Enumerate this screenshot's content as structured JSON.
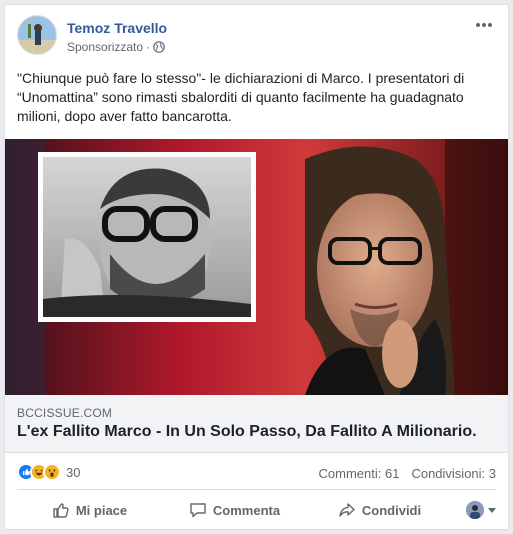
{
  "post": {
    "author": "Temoz Travello",
    "sponsored_label": "Sponsorizzato",
    "sponsored_separator": "·",
    "text": "\"Chiunque può fare lo stesso\"- le dichiarazioni di Marco. I presentatori di “Unomattina” sono rimasti sbalorditi di quanto facilmente ha guadagnato milioni, dopo aver fatto bancarotta."
  },
  "link_preview": {
    "domain": "BCCISSUE.COM",
    "title": "L'ex Fallito Marco - In Un Solo Passo, Da Fallito A Milionario."
  },
  "stats": {
    "reactions": [
      "like-icon",
      "haha-icon",
      "wow-icon"
    ],
    "reaction_count": "30",
    "comments": "Commenti: 61",
    "shares": "Condivisioni: 3"
  },
  "actions": {
    "like": "Mi piace",
    "comment": "Commenta",
    "share": "Condividi"
  },
  "colors": {
    "author_link": "#365899",
    "card_bg": "#ffffff",
    "page_bg": "#e9ebee",
    "link_box_bg": "#f2f3f5",
    "like_blue": "#1877f2",
    "haha_yellow": "#f7b125"
  }
}
